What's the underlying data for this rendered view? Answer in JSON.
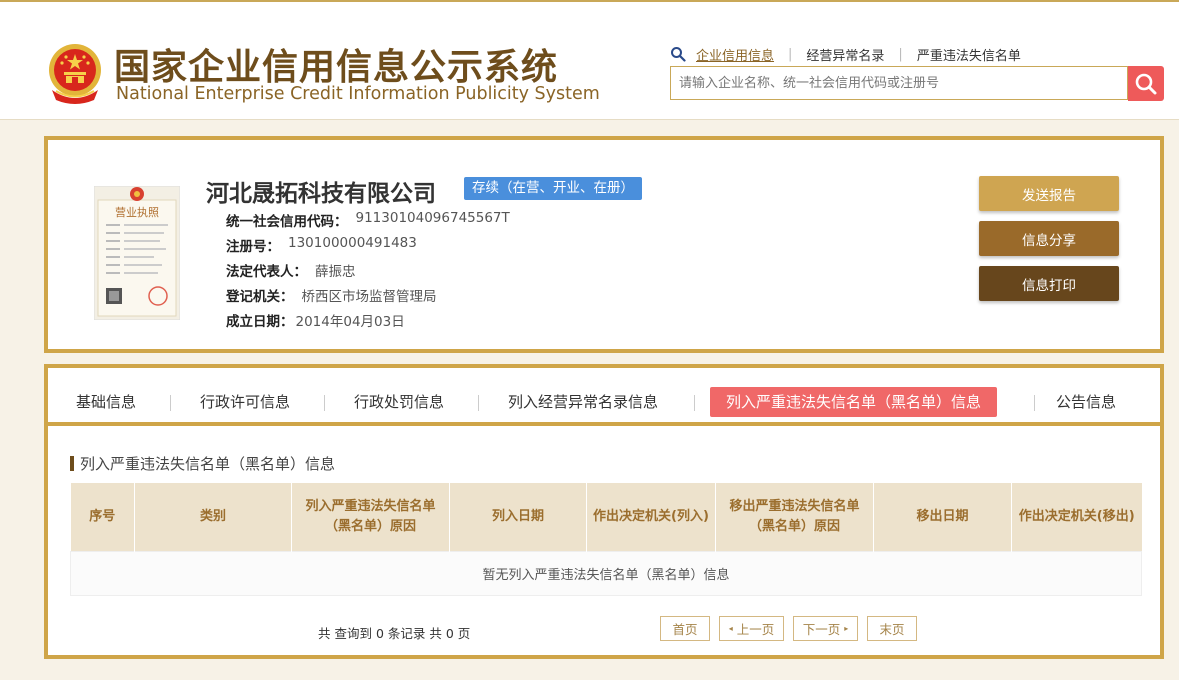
{
  "header": {
    "title_cn": "国家企业信用信息公示系统",
    "title_en": "National Enterprise Credit Information Publicity System",
    "links": [
      "企业信用信息",
      "经营异常名录",
      "严重违法失信名单"
    ],
    "search_placeholder": "请输入企业名称、统一社会信用代码或注册号"
  },
  "company": {
    "name": "河北晟拓科技有限公司",
    "status": "存续（在营、开业、在册）",
    "fields": [
      {
        "label": "统一社会信用代码：",
        "value": "91130104096745567T"
      },
      {
        "label": "注册号：",
        "value": "130100000491483"
      },
      {
        "label": "法定代表人：",
        "value": "薛振忠"
      },
      {
        "label": "登记机关：",
        "value": "桥西区市场监督管理局"
      },
      {
        "label": "成立日期：",
        "value": "2014年04月03日"
      }
    ],
    "license_title": "营业执照",
    "actions": [
      "发送报告",
      "信息分享",
      "信息打印"
    ]
  },
  "tabs": [
    "基础信息",
    "行政许可信息",
    "行政处罚信息",
    "列入经营异常名录信息",
    "列入严重违法失信名单（黑名单）信息",
    "公告信息"
  ],
  "section": {
    "title": "列入严重违法失信名单（黑名单）信息",
    "columns": [
      "序号",
      "类别",
      "列入严重违法失信名单（黑名单）原因",
      "列入日期",
      "作出决定机关(列入)",
      "移出严重违法失信名单（黑名单）原因",
      "移出日期",
      "作出决定机关(移出)"
    ],
    "empty_text": "暂无列入严重违法失信名单（黑名单）信息",
    "total_text": "共 查询到 0 条记录 共 0 页",
    "pager": [
      "首页",
      "上一页",
      "下一页",
      "末页"
    ]
  },
  "colors": {
    "gold_border": "#cfa548",
    "brown_text": "#6e4d1c",
    "status_blue": "#4a8fdc",
    "active_tab_red": "#f06868",
    "search_red": "#ee5a5a"
  }
}
